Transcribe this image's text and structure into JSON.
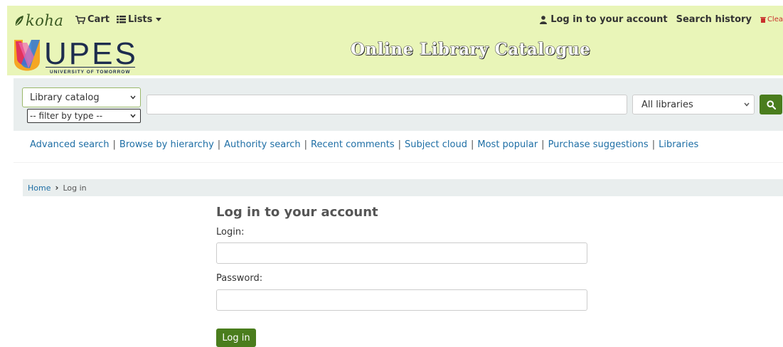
{
  "header": {
    "koha_logo_text": "koha",
    "nav": {
      "cart_label": "Cart",
      "lists_label": "Lists"
    },
    "user": {
      "login_label": "Log in to your account",
      "history_label": "Search history",
      "clear_label": "Clea"
    },
    "logo": {
      "name": "UPES",
      "tagline": "UNIVERSITY OF TOMORROW"
    },
    "catalogue_title": "Online Library Catalogue"
  },
  "search": {
    "catalog_select": "Library catalog",
    "type_select": "-- filter by type --",
    "query_value": "",
    "library_select": "All libraries"
  },
  "more_searches": [
    "Advanced search",
    "Browse by hierarchy",
    "Authority search",
    "Recent comments",
    "Subject cloud",
    "Most popular",
    "Purchase suggestions",
    "Libraries"
  ],
  "breadcrumb": {
    "home": "Home",
    "current": "Log in"
  },
  "login_form": {
    "title": "Log in to your account",
    "login_label": "Login:",
    "login_value": "",
    "password_label": "Password:",
    "password_value": "",
    "submit_label": "Log in"
  },
  "colors": {
    "header_bg": "#e9f5b8",
    "accent_green": "#4a7d1d",
    "link_blue": "#1e6ea5"
  }
}
